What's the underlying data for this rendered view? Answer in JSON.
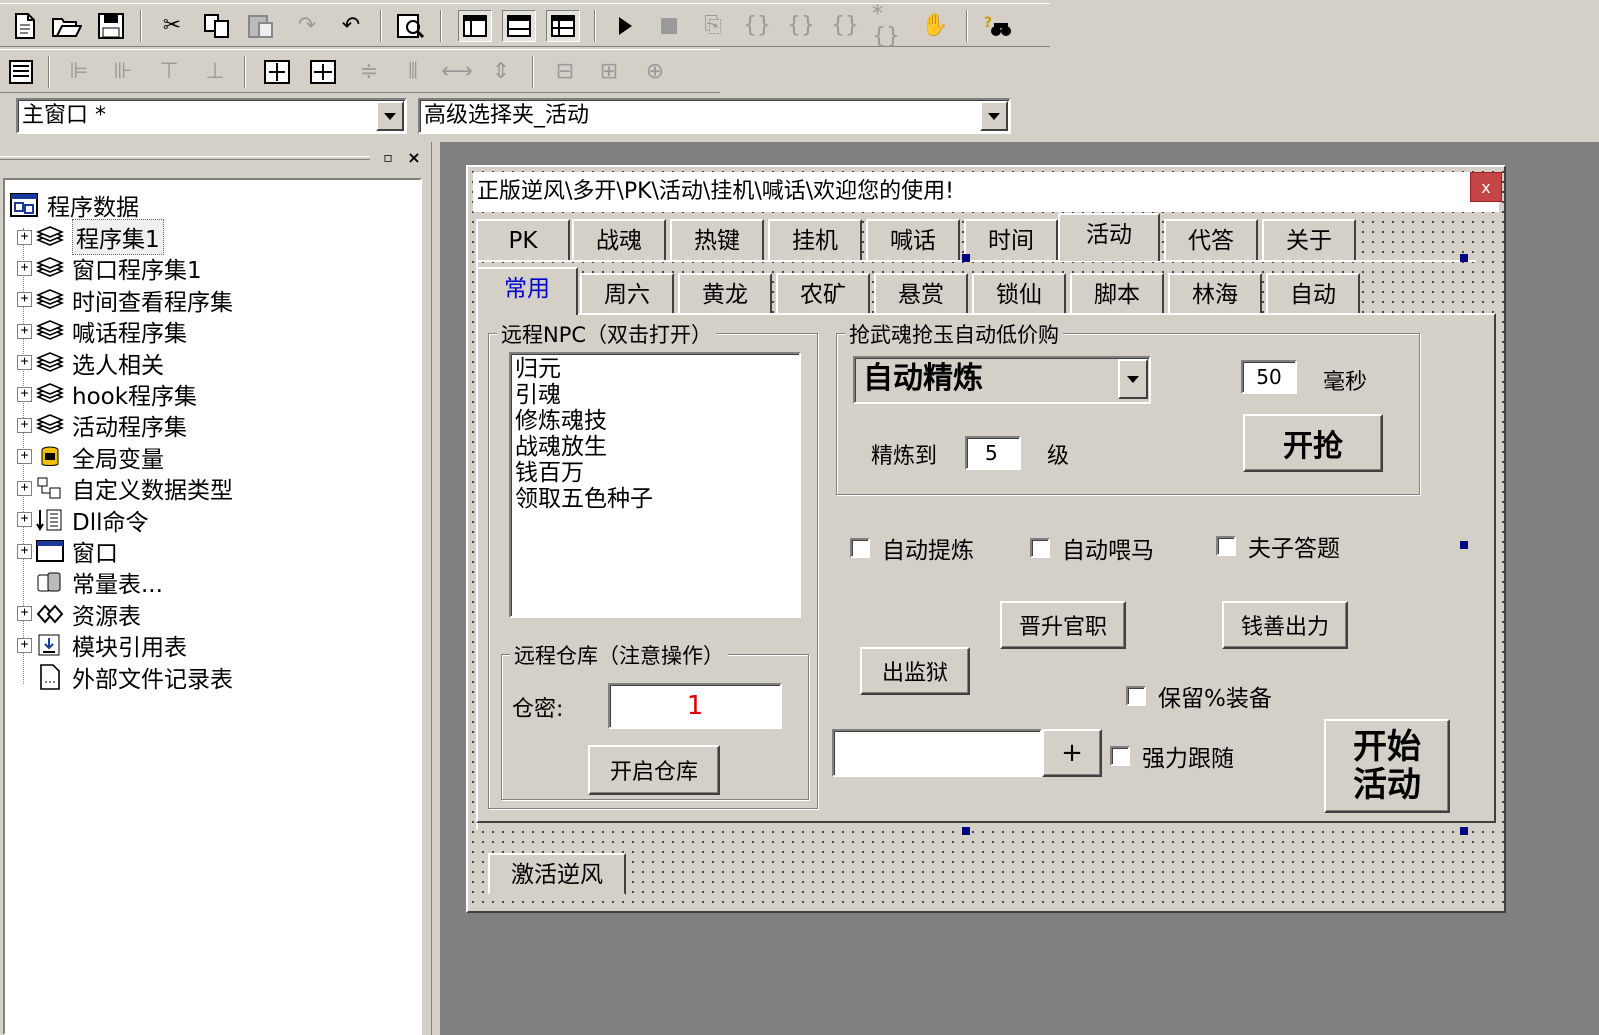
{
  "toolbar1": {
    "icons": [
      "new-file-icon",
      "open-folder-icon",
      "save-icon",
      "cut-icon",
      "copy-icon",
      "paste-icon",
      "redo-icon",
      "undo-icon",
      "find-icon",
      "layout-1-icon",
      "layout-2-icon",
      "layout-3-icon",
      "run-icon",
      "stop-icon",
      "step-icon",
      "step-into-icon",
      "step-over-icon",
      "step-out-icon",
      "run-to-cursor-icon",
      "hand-icon",
      "help-search-icon"
    ]
  },
  "toolbar2": {
    "icons": [
      "form-icon",
      "align-left-icon",
      "align-center-icon",
      "align-top-icon",
      "align-bottom-icon",
      "same-width-icon",
      "same-height-icon",
      "center-h-icon",
      "center-v-icon",
      "space-h-icon",
      "space-v-icon",
      "size-width-icon",
      "size-height-icon",
      "size-both-icon"
    ]
  },
  "combos": {
    "window_select": "主窗口 *",
    "control_select": "高级选择夹_活动"
  },
  "tree": {
    "root": "程序数据",
    "items": [
      {
        "label": "程序集1",
        "icon": "module-stack-icon",
        "expand": "+"
      },
      {
        "label": "窗口程序集1",
        "icon": "module-stack-icon",
        "expand": "+"
      },
      {
        "label": "时间查看程序集",
        "icon": "module-stack-icon",
        "expand": "+"
      },
      {
        "label": "喊话程序集",
        "icon": "module-stack-icon",
        "expand": "+"
      },
      {
        "label": "选人相关",
        "icon": "module-stack-icon",
        "expand": "+"
      },
      {
        "label": "hook程序集",
        "icon": "module-stack-icon",
        "expand": "+"
      },
      {
        "label": "活动程序集",
        "icon": "module-stack-icon",
        "expand": "+"
      },
      {
        "label": "全局变量",
        "icon": "database-icon",
        "expand": "+"
      },
      {
        "label": "自定义数据类型",
        "icon": "datatype-icon",
        "expand": "+"
      },
      {
        "label": "Dll命令",
        "icon": "dll-icon",
        "expand": "+"
      },
      {
        "label": "窗口",
        "icon": "window-icon",
        "expand": "+"
      },
      {
        "label": "常量表...",
        "icon": "constant-icon",
        "expand": ""
      },
      {
        "label": "资源表",
        "icon": "resource-icon",
        "expand": "+"
      },
      {
        "label": "模块引用表",
        "icon": "module-ref-icon",
        "expand": "+"
      },
      {
        "label": "外部文件记录表",
        "icon": "document-icon",
        "expand": ""
      }
    ]
  },
  "form": {
    "title": "正版逆风\\多开\\PK\\活动\\挂机\\喊话\\欢迎您的使用!",
    "close": "x",
    "tabs_top": [
      "PK",
      "战魂",
      "热键",
      "挂机",
      "喊话",
      "时间",
      "活动",
      "代答",
      "关于"
    ],
    "tabs_sub": [
      "常用",
      "周六",
      "黄龙",
      "农矿",
      "悬赏",
      "锁仙",
      "脚本",
      "林海",
      "自动"
    ],
    "npc_group": "远程NPC（双击打开）",
    "npc_list": [
      "归元",
      "引魂",
      "修炼魂技",
      "战魂放生",
      "钱百万",
      "领取五色种子"
    ],
    "warehouse_group": "远程仓库（注意操作）",
    "warehouse_pw_label": "仓密:",
    "warehouse_pw_value": "1",
    "warehouse_btn": "开启仓库",
    "buy_group": "抢武魂抢玉自动低价购",
    "buy_select": "自动精炼",
    "ms_value": "50",
    "ms_unit": "毫秒",
    "grab_btn": "开抢",
    "refine_label": "精炼到",
    "refine_value": "5",
    "refine_unit": "级",
    "chk_refine": "自动提炼",
    "chk_feed": "自动喂马",
    "chk_answer": "夫子答题",
    "btn_promote": "晋升官职",
    "btn_donate": "钱善出力",
    "btn_jail": "出监狱",
    "chk_keep": "保留%装备",
    "plus": "+",
    "chk_follow": "强力跟随",
    "btn_start_line1": "开始",
    "btn_start_line2": "活动",
    "bottom_tab": "激活逆风"
  }
}
